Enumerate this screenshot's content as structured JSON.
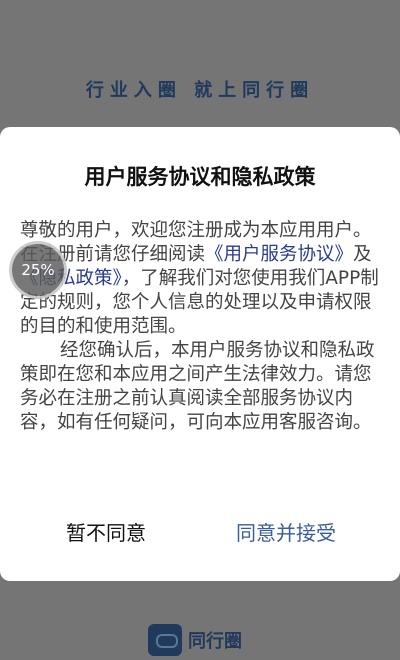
{
  "splash": {
    "slogan": "行业入圈 就上同行圈"
  },
  "dialog": {
    "title": "用户服务协议和隐私政策",
    "para1": {
      "t1": "尊敬的用户，欢迎您注册成为本应用用户。在注册前请您仔细阅读",
      "link1": "《用户服务协议》",
      "t2": "及",
      "link2": "《隐私政策》",
      "t3": "，了解我们对您使用我们APP制定的规则，您个人信息的处理以及申请权限的目的和使用范围。"
    },
    "para2": "经您确认后，本用户服务协议和隐私政策即在您和本应用之间产生法律效力。请您务必在注册之前认真阅读全部服务协议内容，如有任何疑问，可向本应用客服咨询。",
    "decline_label": "暂不同意",
    "accept_label": "同意并接受"
  },
  "progress": {
    "label": "25%"
  },
  "footer": {
    "logo_text": "同行圈"
  },
  "colors": {
    "overlay": "#757575",
    "link": "#2b3b8f",
    "accept": "#3a5e9c",
    "brand": "#1f3a5c"
  }
}
